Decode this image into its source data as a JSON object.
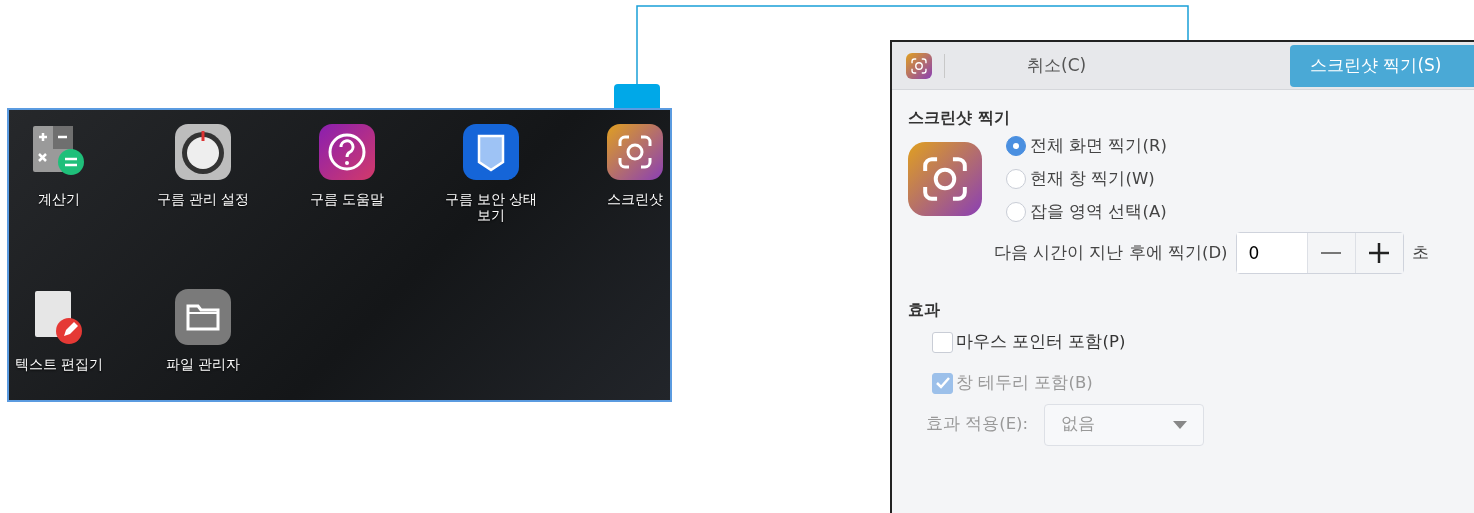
{
  "launcher": {
    "apps": [
      {
        "label": "계산기",
        "kind": "calculator"
      },
      {
        "label": "구름 관리 설정",
        "kind": "dial"
      },
      {
        "label": "구름 도움말",
        "kind": "help"
      },
      {
        "label": "구름 보안 상태\n보기",
        "kind": "shield"
      },
      {
        "label": "스크린샷",
        "kind": "screenshot"
      },
      {
        "label": "텍스트 편집기",
        "kind": "editor"
      },
      {
        "label": "파일 관리자",
        "kind": "folder"
      }
    ]
  },
  "dialog": {
    "cancel_button": "취소(C)",
    "take_button": "스크린샷 찍기(S)",
    "capture_section": {
      "title": "스크린샷 찍기",
      "options": [
        {
          "label": "전체 화면 찍기(R)",
          "selected": true
        },
        {
          "label": "현재 창 찍기(W)",
          "selected": false
        },
        {
          "label": "잡을 영역 선택(A)",
          "selected": false
        }
      ],
      "delay": {
        "label": "다음 시간이 지난 후에 찍기(D)",
        "value": "0",
        "unit": "초"
      }
    },
    "effects_section": {
      "title": "효과",
      "checkboxes": [
        {
          "label": "마우스 포인터 포함(P)",
          "checked": false,
          "disabled": false
        },
        {
          "label": "창 테두리 포함(B)",
          "checked": true,
          "disabled": true
        }
      ],
      "apply": {
        "label": "효과 적용(E):",
        "value": "없음",
        "disabled": true
      }
    }
  }
}
